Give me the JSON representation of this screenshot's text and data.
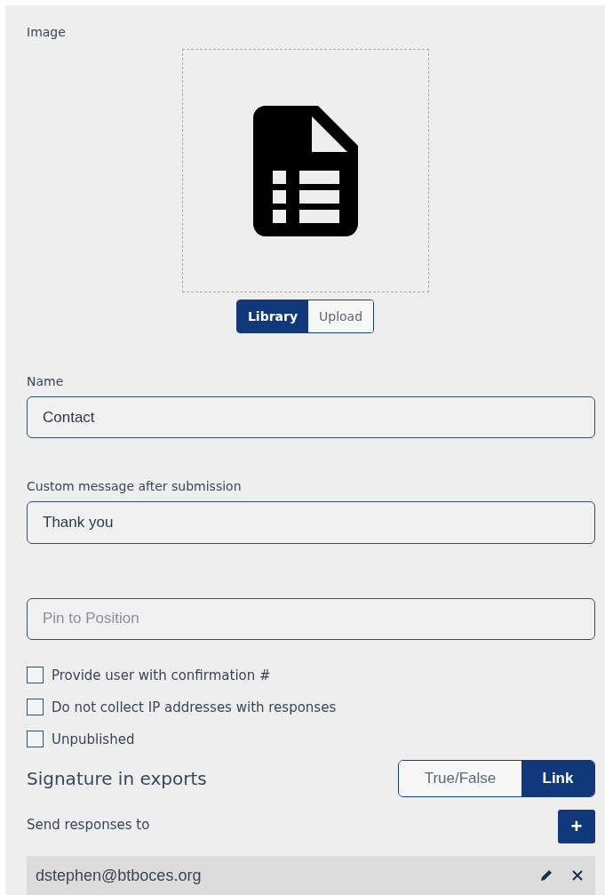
{
  "image": {
    "label": "Image",
    "source_options": [
      {
        "label": "Library",
        "selected": true
      },
      {
        "label": "Upload",
        "selected": false
      }
    ]
  },
  "fields": [
    {
      "label": "Name",
      "value": "Contact"
    },
    {
      "label": "Custom message after submission",
      "value": "Thank you"
    },
    {
      "placeholder": "Pin to Position"
    }
  ],
  "checkboxes": [
    {
      "label": "Provide user with confirmation #",
      "checked": false
    },
    {
      "label": "Do not collect IP addresses with responses",
      "checked": false
    },
    {
      "label": "Unpublished",
      "checked": false
    }
  ],
  "signature": {
    "label": "Signature in exports",
    "options": [
      {
        "label": "True/False",
        "selected": false
      },
      {
        "label": "Link",
        "selected": true
      }
    ]
  },
  "responses": {
    "label": "Send responses to",
    "add_button": "+",
    "recipients": [
      {
        "email": "dstephen@btboces.org"
      }
    ]
  }
}
